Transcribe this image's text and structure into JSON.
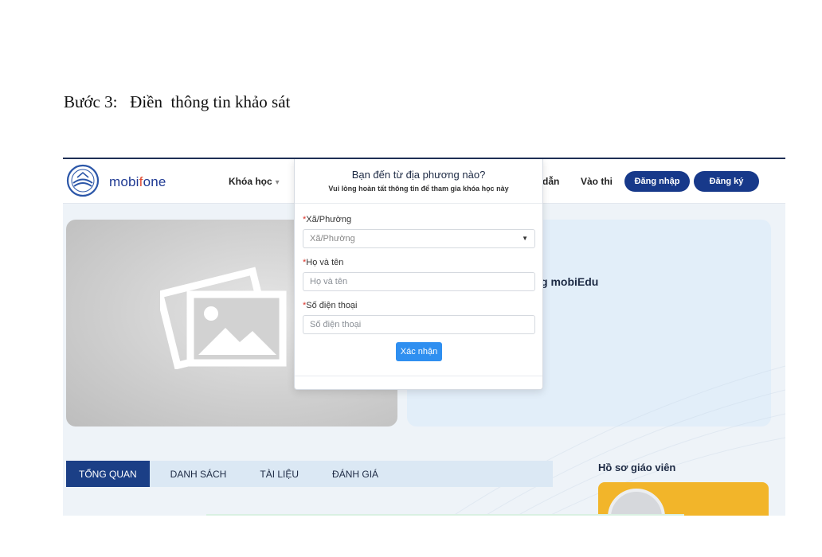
{
  "document": {
    "heading": "Bước 3:   Điền  thông tin khảo sát"
  },
  "header": {
    "brand_prefix": "mobi",
    "brand_accent": "f",
    "brand_suffix": "one",
    "nav_courses": "Khóa học",
    "nav_guide_partial": "dẫn",
    "nav_exam": "Vào thi",
    "login_label": "Đăng nhập",
    "register_label": "Đăng ký"
  },
  "hero": {
    "title_partial": "g mobiEdu"
  },
  "tabs": [
    {
      "label": "TỔNG QUAN",
      "active": true
    },
    {
      "label": "DANH SÁCH",
      "active": false
    },
    {
      "label": "TÀI LIỆU",
      "active": false
    },
    {
      "label": "ĐÁNH GIÁ",
      "active": false
    }
  ],
  "sidebar": {
    "teacher_profile_title": "Hồ sơ giáo viên"
  },
  "modal": {
    "title": "Bạn đến từ địa phương nào?",
    "subtitle": "Vui lòng hoàn tất thông tin để tham gia khóa học này",
    "required_mark": "*",
    "ward": {
      "label": "Xã/Phường",
      "placeholder": "Xã/Phường"
    },
    "full_name": {
      "label": "Họ và tên",
      "placeholder": "Họ và tên"
    },
    "phone": {
      "label": "Số điện thoại",
      "placeholder": "Số điện thoại"
    },
    "submit_label": "Xác nhận"
  },
  "colors": {
    "primary_navy": "#17398a",
    "submit_blue": "#2f8ff0",
    "teacher_card": "#f2b52a",
    "brand_accent": "#e04a2f"
  }
}
